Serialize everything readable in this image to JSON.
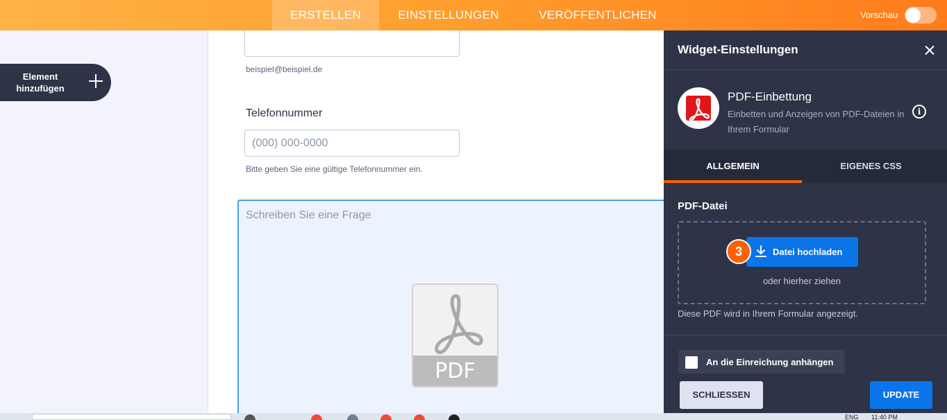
{
  "topbar": {
    "tabs": [
      {
        "label": "ERSTELLEN",
        "active": true
      },
      {
        "label": "EINSTELLUNGEN",
        "active": false
      },
      {
        "label": "VERÖFFENTLICHEN",
        "active": false
      }
    ],
    "preview_label": "Vorschau",
    "preview_enabled": false
  },
  "sidebar": {
    "add_element_label": "Element hinzufügen"
  },
  "form": {
    "email_hint": "beispiel@beispiel.de",
    "phone_label": "Telefonnummer",
    "phone_placeholder": "(000) 000-0000",
    "phone_hint": "Bitte geben Sie eine gültige Telefonnummer ein.",
    "question_placeholder": "Schreiben Sie eine Frage",
    "pdf_placeholder_text": "PDF"
  },
  "panel": {
    "title": "Widget-Einstellungen",
    "widget_name": "PDF-Einbettung",
    "widget_description": "Einbetten und Anzeigen von PDF-Dateien in Ihrem Formular",
    "tabs": [
      {
        "label": "ALLGEMEIN",
        "active": true
      },
      {
        "label": "EIGENES CSS",
        "active": false
      }
    ],
    "pdf_field_label": "PDF-Datei",
    "upload_button_label": "Datei hochladen",
    "step_badge": "3",
    "drag_text": "oder hierher ziehen",
    "field_help": "Diese PDF wird in Ihrem Formular angezeigt.",
    "attach_label": "An die Einreichung anhängen",
    "attach_checked": false,
    "close_button_label": "SCHLIESSEN",
    "update_button_label": "UPDATE"
  },
  "taskbar": {
    "language": "ENG",
    "time": "11:40 PM"
  },
  "colors": {
    "accent_orange": "#ff6100",
    "primary_blue": "#0a75e8",
    "panel_bg": "#2e3347"
  }
}
